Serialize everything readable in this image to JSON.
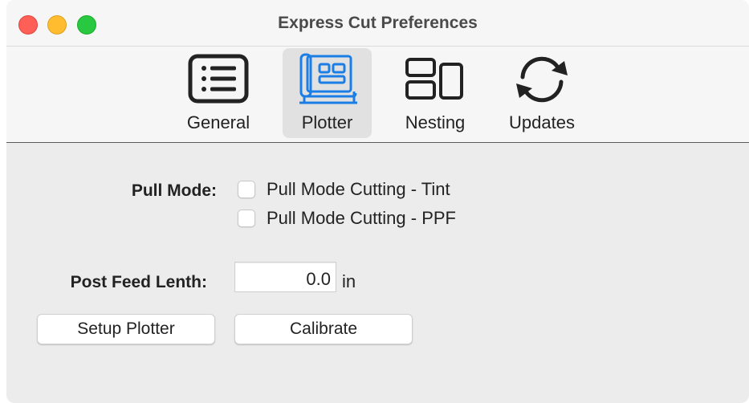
{
  "window": {
    "title": "Express Cut Preferences"
  },
  "toolbar": {
    "tabs": [
      {
        "label": "General",
        "icon": "list-icon",
        "selected": false
      },
      {
        "label": "Plotter",
        "icon": "plotter-icon",
        "selected": true
      },
      {
        "label": "Nesting",
        "icon": "nesting-icon",
        "selected": false
      },
      {
        "label": "Updates",
        "icon": "refresh-icon",
        "selected": false
      }
    ],
    "accent_color": "#1a7ee6"
  },
  "pull_mode": {
    "label": "Pull Mode:",
    "options": [
      {
        "label": "Pull Mode Cutting - Tint",
        "checked": false
      },
      {
        "label": "Pull Mode Cutting - PPF",
        "checked": false
      }
    ]
  },
  "post_feed": {
    "label": "Post Feed Lenth:",
    "value": "0.0",
    "unit": "in"
  },
  "buttons": {
    "setup_plotter": "Setup Plotter",
    "calibrate": "Calibrate"
  }
}
